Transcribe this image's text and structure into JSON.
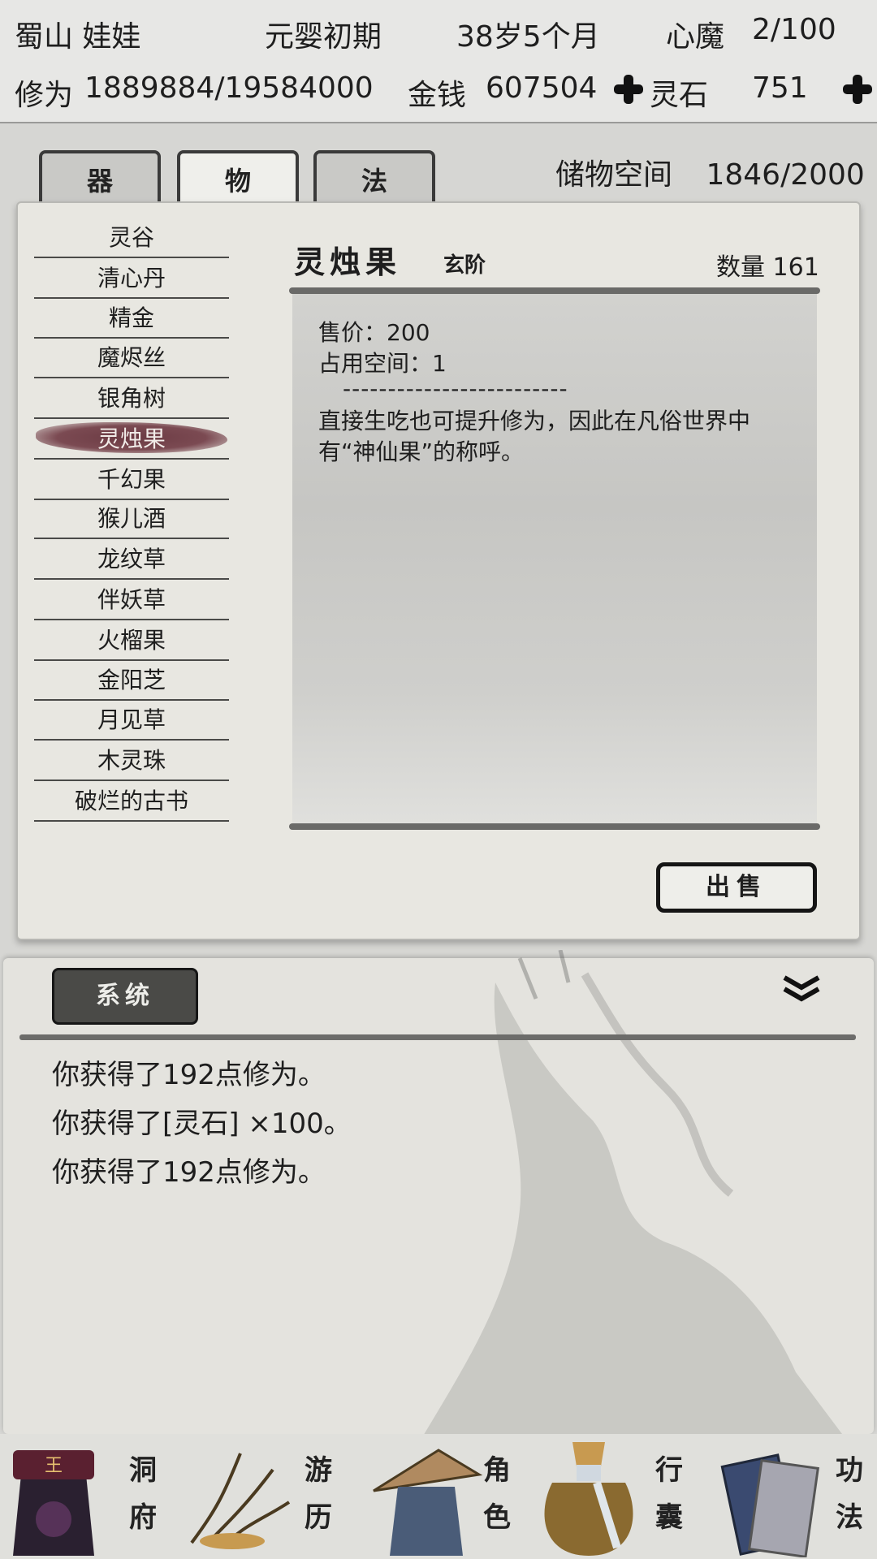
{
  "header": {
    "character_name": "蜀山 娃娃",
    "realm": "元婴初期",
    "age": "38岁5个月",
    "heart_demon_label": "心魔",
    "heart_demon_value": "2/100",
    "cultivation_label": "修为",
    "cultivation_value": "1889884/19584000",
    "money_label": "金钱",
    "money_value": "607504",
    "spirit_stone_label": "灵石",
    "spirit_stone_value": "751"
  },
  "tabs": [
    {
      "label": "器"
    },
    {
      "label": "物",
      "active": true
    },
    {
      "label": "法"
    }
  ],
  "storage": {
    "label": "储物空间",
    "value": "1846/2000"
  },
  "items": [
    {
      "label": "灵谷"
    },
    {
      "label": "清心丹"
    },
    {
      "label": "精金"
    },
    {
      "label": "魔烬丝"
    },
    {
      "label": "银角树"
    },
    {
      "label": "灵烛果",
      "selected": true
    },
    {
      "label": "千幻果"
    },
    {
      "label": "猴儿酒"
    },
    {
      "label": "龙纹草"
    },
    {
      "label": "伴妖草"
    },
    {
      "label": "火榴果"
    },
    {
      "label": "金阳芝"
    },
    {
      "label": "月见草"
    },
    {
      "label": "木灵珠"
    },
    {
      "label": "破烂的古书"
    }
  ],
  "detail": {
    "name": "灵烛果",
    "grade": "玄阶",
    "quantity": "数量 161",
    "price": "售价：200",
    "space": "占用空间：1",
    "separator": "-------------------------",
    "description": "直接生吃也可提升修为，因此在凡俗世界中有“神仙果”的称呼。"
  },
  "sell_button": "出售",
  "messages": {
    "tab_label": "系统",
    "lines": [
      "你获得了192点修为。",
      "你获得了[灵石] ×100。",
      "你获得了192点修为。"
    ]
  },
  "nav": [
    {
      "label_top": "洞",
      "label_bottom": "府",
      "icon": "cave-icon"
    },
    {
      "label_top": "游",
      "label_bottom": "历",
      "icon": "travel-icon"
    },
    {
      "label_top": "角",
      "label_bottom": "色",
      "icon": "character-icon"
    },
    {
      "label_top": "行",
      "label_bottom": "囊",
      "icon": "bag-icon"
    },
    {
      "label_top": "功",
      "label_bottom": "法",
      "icon": "scripture-icon"
    }
  ],
  "colors": {
    "selected_brush": "#6b3a43",
    "panel": "#e8e7e1",
    "dark_button": "#4a4a47"
  }
}
